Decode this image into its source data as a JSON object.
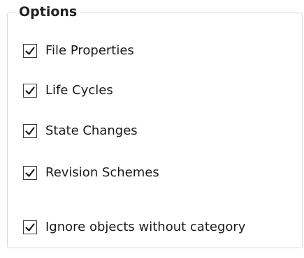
{
  "group": {
    "title": "Options",
    "options": [
      {
        "label": "File Properties",
        "checked": true
      },
      {
        "label": "Life Cycles",
        "checked": true
      },
      {
        "label": "State Changes",
        "checked": true
      },
      {
        "label": "Revision Schemes",
        "checked": true
      },
      {
        "label": "Ignore objects without category",
        "checked": true
      }
    ]
  }
}
